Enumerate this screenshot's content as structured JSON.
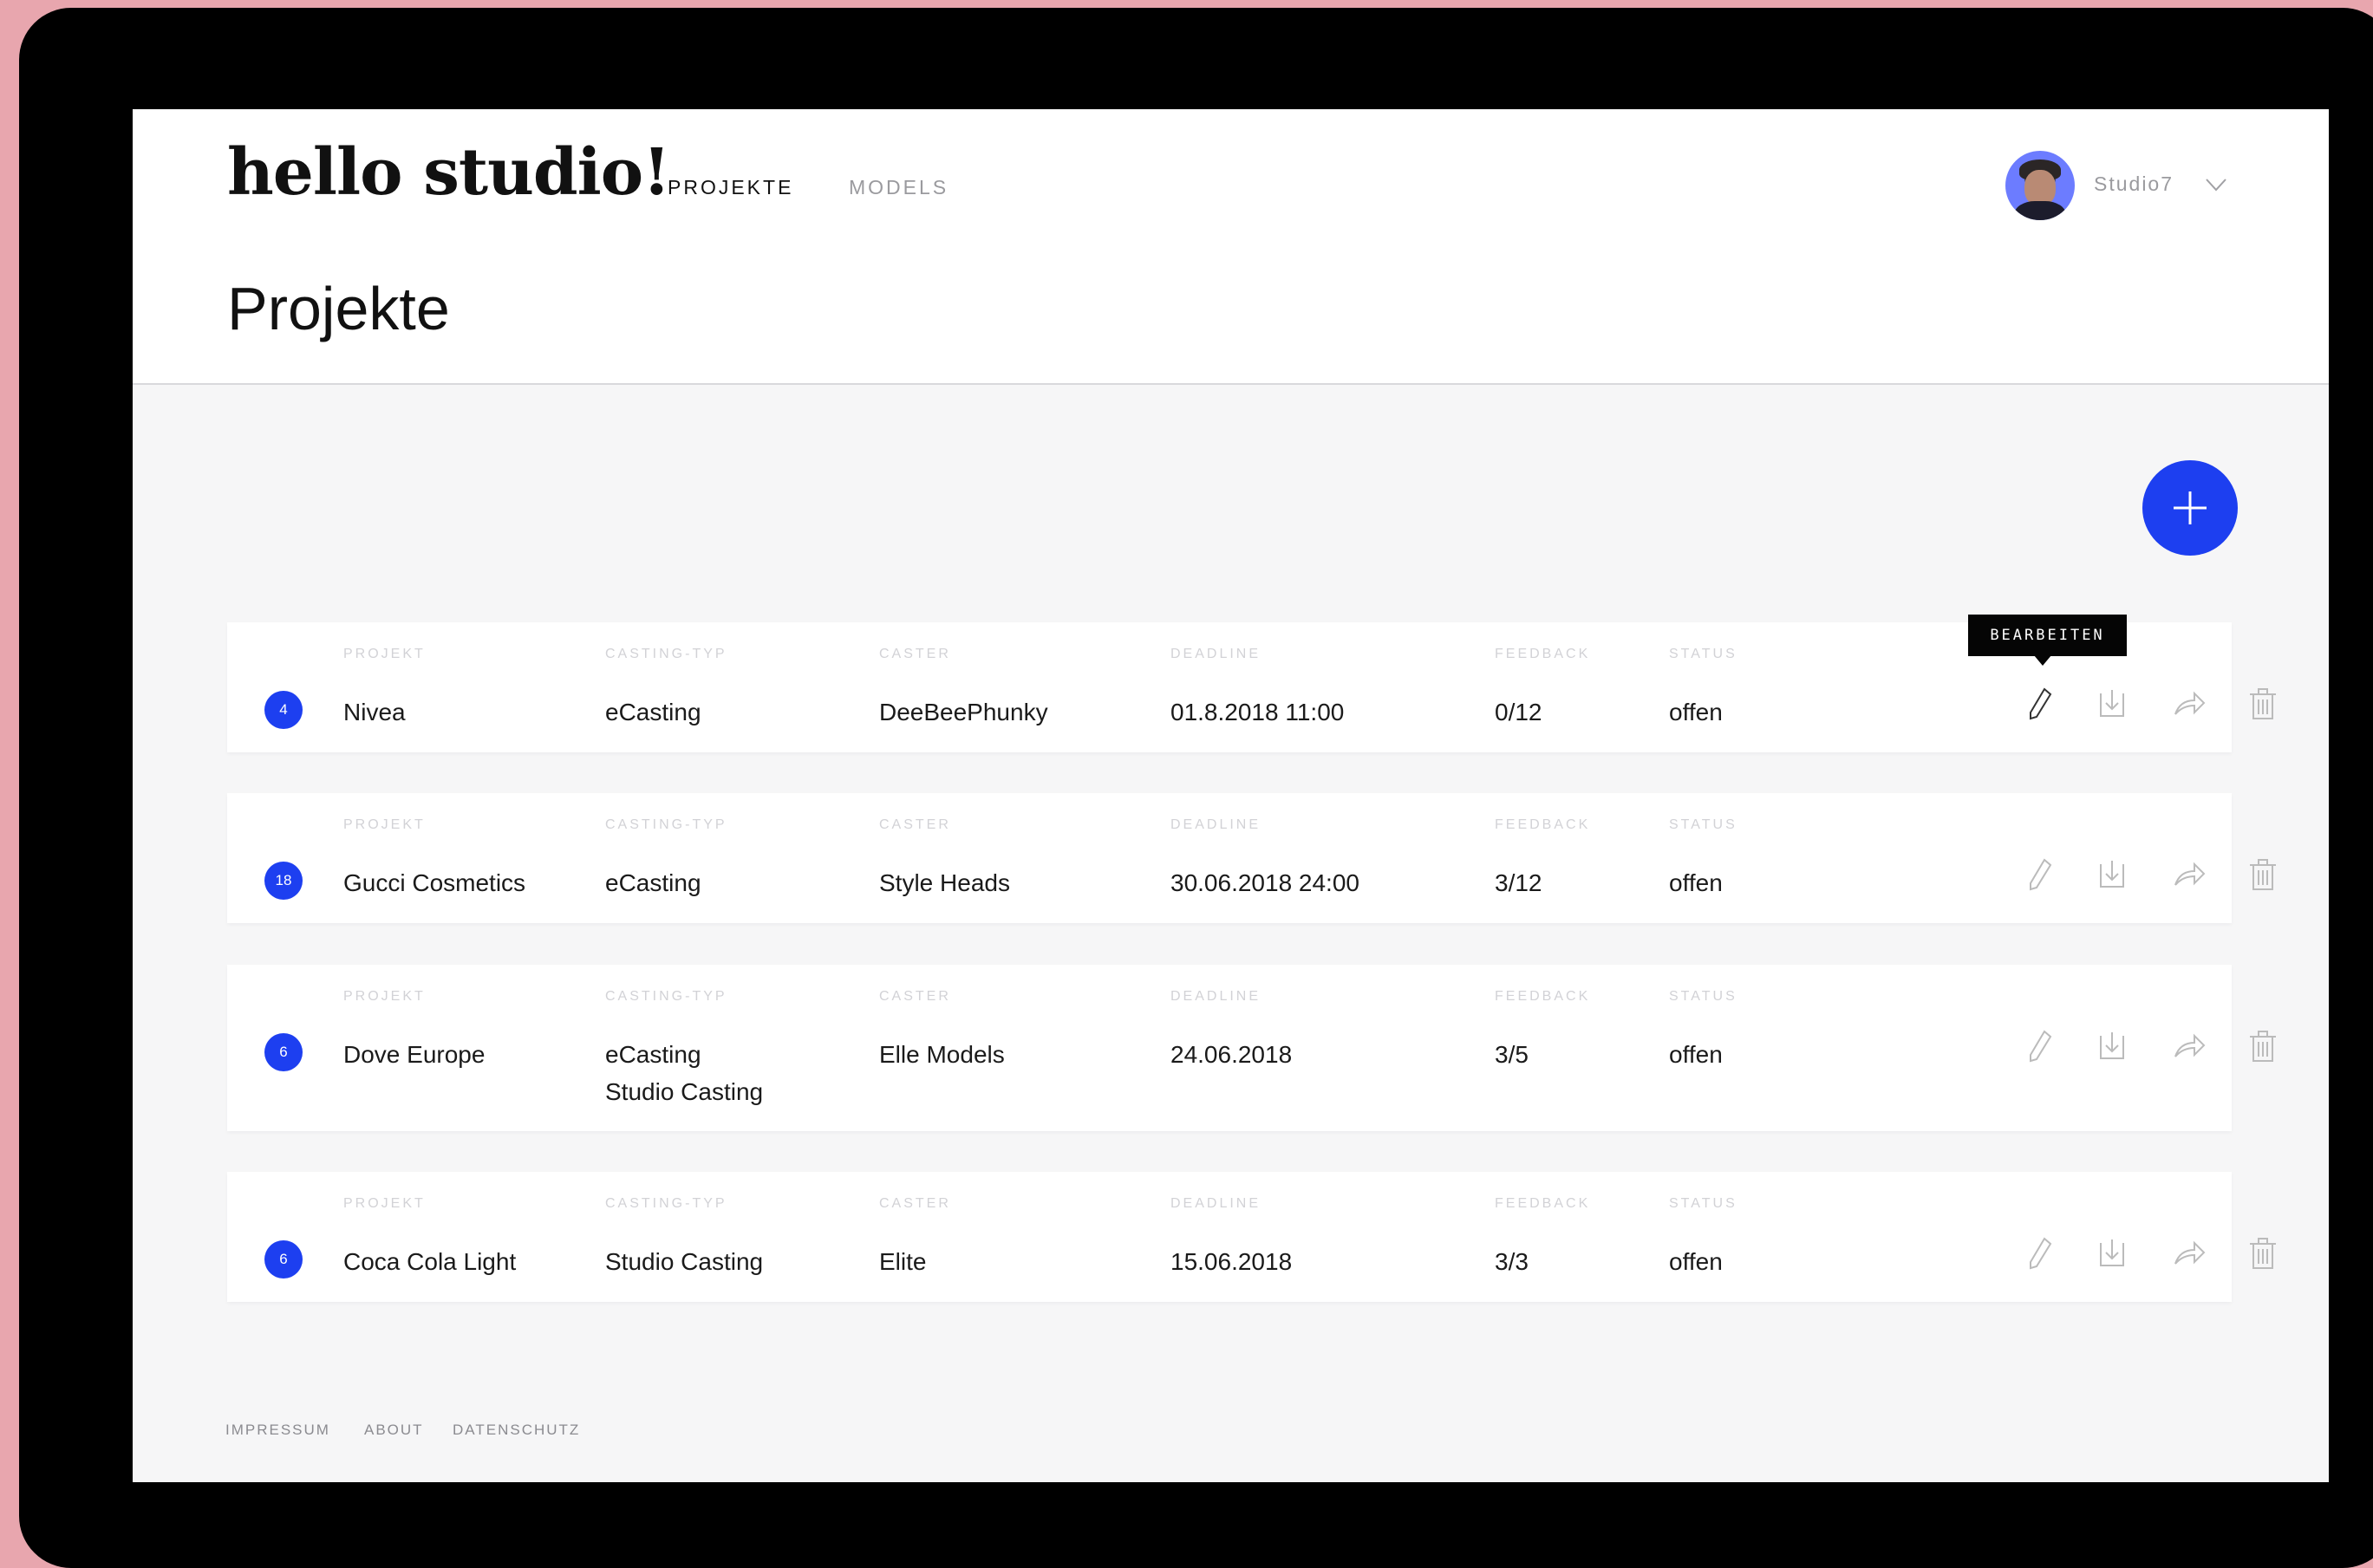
{
  "header": {
    "logo": "hello studio!",
    "nav": [
      {
        "label": "PROJEKTE",
        "active": true
      },
      {
        "label": "MODELS",
        "active": false
      }
    ],
    "user": {
      "name": "Studio7"
    }
  },
  "page_title": "Projekte",
  "fab_icon": "plus-icon",
  "columns": [
    "PROJEKT",
    "CASTING-TYP",
    "CASTER",
    "DEADLINE",
    "FEEDBACK",
    "STATUS"
  ],
  "tooltip": "BEARBEITEN",
  "rows": [
    {
      "count": "4",
      "project": "Nivea",
      "casting_type": "eCasting",
      "casting_type_2": "",
      "caster": "DeeBeePhunky",
      "deadline": "01.8.2018 11:00",
      "feedback": "0/12",
      "status": "offen"
    },
    {
      "count": "18",
      "project": "Gucci Cosmetics",
      "casting_type": "eCasting",
      "casting_type_2": "",
      "caster": "Style Heads",
      "deadline": "30.06.2018 24:00",
      "feedback": "3/12",
      "status": "offen"
    },
    {
      "count": "6",
      "project": "Dove Europe",
      "casting_type": "eCasting",
      "casting_type_2": "Studio Casting",
      "caster": "Elle Models",
      "deadline": "24.06.2018",
      "feedback": "3/5",
      "status": "offen"
    },
    {
      "count": "6",
      "project": "Coca Cola Light",
      "casting_type": "Studio Casting",
      "casting_type_2": "",
      "caster": "Elite",
      "deadline": "15.06.2018",
      "feedback": "3/3",
      "status": "offen"
    }
  ],
  "actions": [
    "edit-icon",
    "download-icon",
    "share-icon",
    "trash-icon"
  ],
  "footer": [
    "IMPRESSUM",
    "ABOUT",
    "DATENSCHUTZ"
  ],
  "colors": {
    "accent": "#1d3ff0",
    "background": "#e8a6ae"
  }
}
